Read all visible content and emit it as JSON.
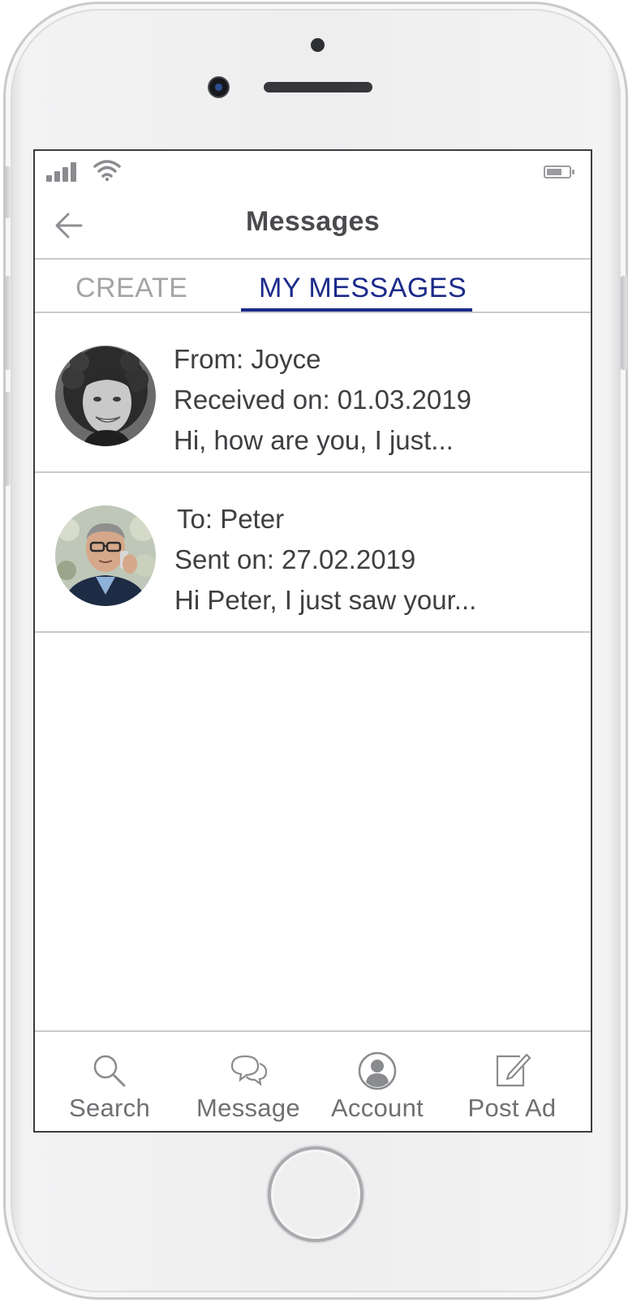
{
  "header": {
    "title": "Messages"
  },
  "tabs": [
    {
      "label": "CREATE",
      "active": false
    },
    {
      "label": "MY MESSAGES",
      "active": true
    }
  ],
  "messages": [
    {
      "line1": "From: Joyce",
      "line2": "Received on: 01.03.2019",
      "line3": "Hi, how are you, I just..."
    },
    {
      "line1": "To: Peter",
      "line2": "Sent on: 27.02.2019",
      "line3": "Hi Peter, I just saw your..."
    }
  ],
  "bottom_nav": [
    {
      "label": "Search",
      "icon": "search-icon"
    },
    {
      "label": "Message",
      "icon": "chat-bubbles-icon"
    },
    {
      "label": "Account",
      "icon": "user-avatar-icon"
    },
    {
      "label": "Post Ad",
      "icon": "edit-note-icon"
    }
  ],
  "colors": {
    "accent": "#1b2a8a",
    "inactive_tab": "#a3a4a7",
    "text": "#3e3f42",
    "divider": "#c9c9cb"
  }
}
